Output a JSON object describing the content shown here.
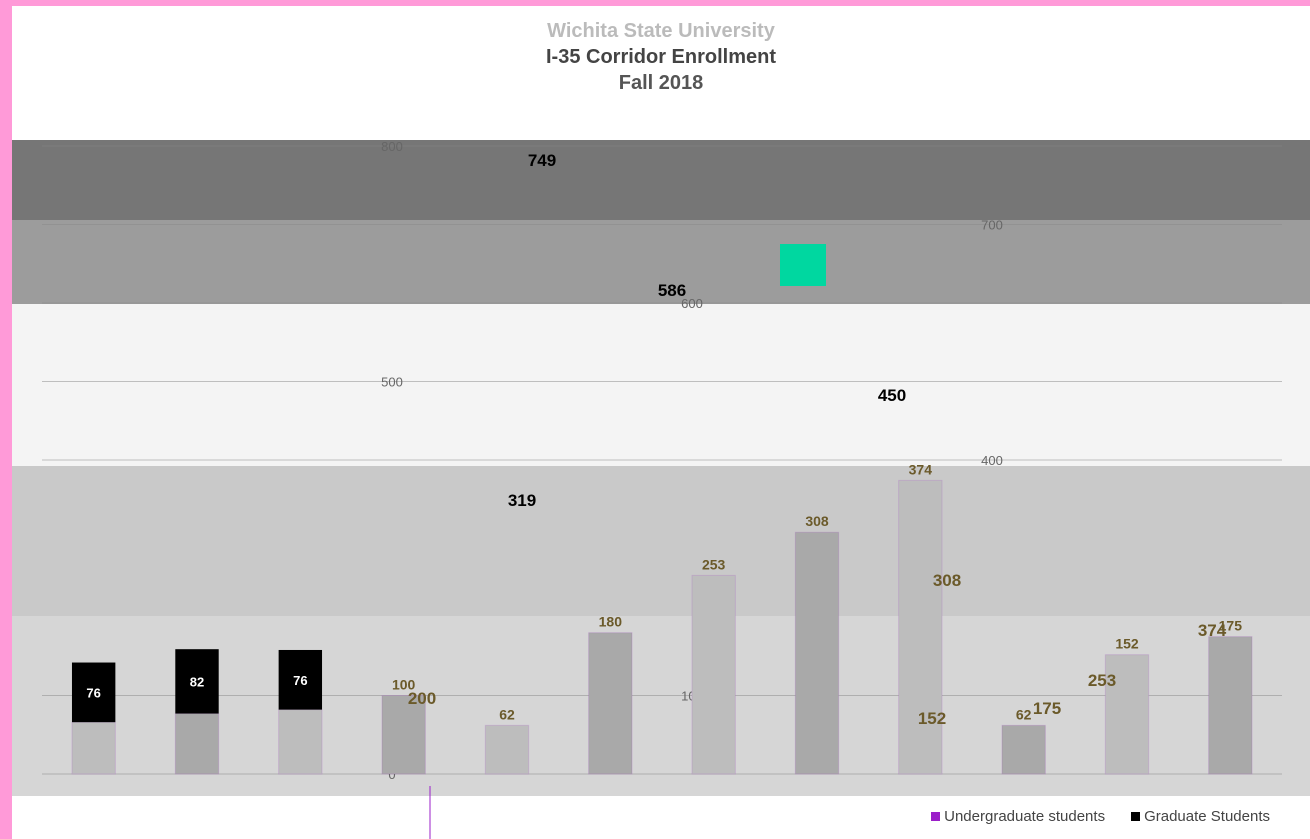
{
  "chart_data": {
    "type": "bar",
    "title": "Wichita State University",
    "subtitle": "I-35 Corridor Enrollment",
    "term": "Fall 2018",
    "categories": [
      "",
      "",
      "",
      "",
      "",
      "",
      "",
      "",
      "",
      "",
      "",
      ""
    ],
    "series": [
      {
        "name": "Undergraduate students",
        "color": "#9b1fc9",
        "values": [
          66,
          77,
          82,
          100,
          62,
          180,
          253,
          308,
          374,
          62,
          152,
          175
        ]
      },
      {
        "name": "Graduate Students",
        "color": "#000000",
        "values": [
          76,
          82,
          76,
          0,
          0,
          0,
          0,
          0,
          0,
          0,
          0,
          0
        ]
      }
    ],
    "totals": [
      "749",
      "586",
      "450",
      "319",
      "200",
      "374",
      "253",
      "308",
      "152",
      "175"
    ],
    "y_ticks": [
      "0",
      "100",
      "400",
      "500",
      "600",
      "700",
      "800"
    ],
    "ylim": [
      0,
      800
    ],
    "legend_position": "bottom-right"
  },
  "legend": {
    "undergrad": "Undergraduate students",
    "grad": "Graduate Students",
    "undergrad_color": "#9b1fc9",
    "grad_color": "#000000"
  }
}
